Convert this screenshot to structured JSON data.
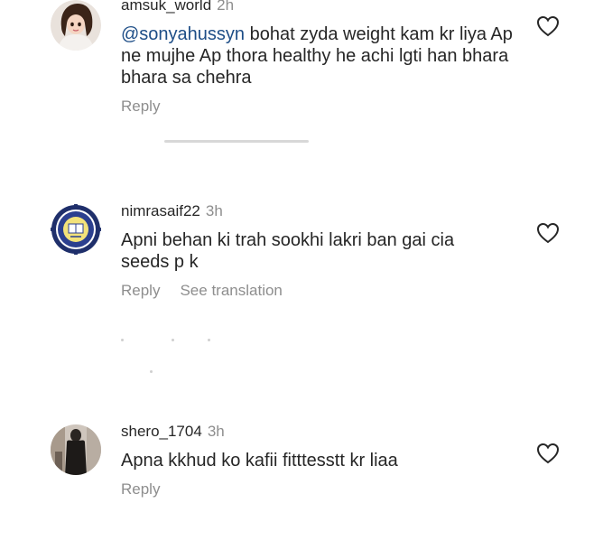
{
  "comments": [
    {
      "username": "amsuk_world",
      "time": "2h",
      "mention": "@sonyahussyn",
      "text": " bohat zyda weight kam kr liya Ap ne mujhe Ap thora healthy he achi lgti han bhara bhara sa chehra",
      "reply_label": "Reply",
      "avatar_icon": "cartoon-girl-avatar"
    },
    {
      "username": "nimrasaif22",
      "time": "3h",
      "text": "Apni behan ki trah sookhi lakri ban gai cia seeds p k",
      "reply_label": "Reply",
      "translate_label": "See translation",
      "avatar_icon": "school-emblem-avatar"
    },
    {
      "username": "shero_1704",
      "time": "3h",
      "text": "Apna kkhud ko kafii fitttesstt kr liaa",
      "reply_label": "Reply",
      "avatar_icon": "person-photo-avatar"
    }
  ],
  "colors": {
    "text": "#262626",
    "secondary": "#8e8e8e",
    "mention": "#1e4e87"
  },
  "icons": {
    "like": "heart-outline-icon"
  }
}
